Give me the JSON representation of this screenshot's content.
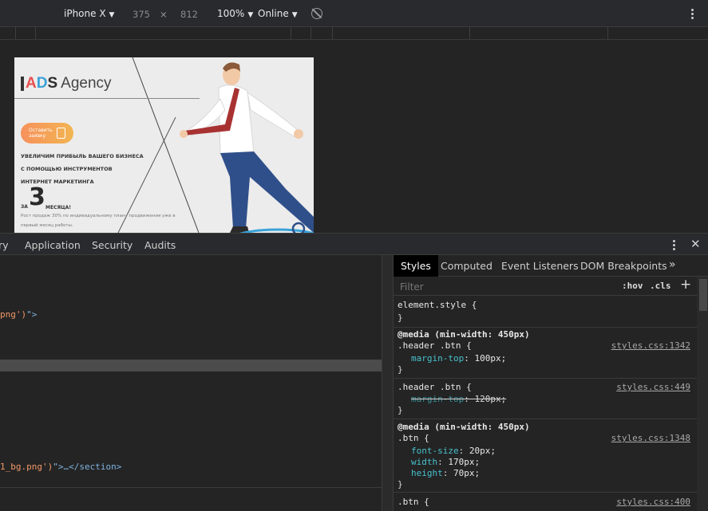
{
  "device_toolbar": {
    "device": "iPhone X",
    "width": "375",
    "times": "×",
    "height": "812",
    "zoom": "100%",
    "network": "Online"
  },
  "page": {
    "logo_a": "A",
    "logo_d": "D",
    "logo_s": "S",
    "logo_agency": "Agency",
    "cta_line1": "Оставить",
    "cta_line2": "заявку",
    "headline": [
      "УВЕЛИЧИМ ПРИБЫЛЬ ВАШЕГО БИЗНЕСА",
      "С ПОМОЩЬЮ ИНСТРУМЕНТОВ",
      "ИНТЕРНЕТ МАРКЕТИНГА"
    ],
    "za": "ЗА",
    "big_number": "3",
    "months": "МЕСЯЦА!",
    "note": [
      "Рост продаж 30% по индивидуальному плану продвижения уже в",
      "первый месяц работы."
    ]
  },
  "devtools": {
    "tabs": [
      "ry",
      "Application",
      "Security",
      "Audits"
    ],
    "elements": {
      "line1_str": "png')",
      "line1_tail": "\">",
      "line2_str": "1_bg.png')",
      "line2_tail": "\">…</section>"
    },
    "styles_tabs": [
      "Styles",
      "Computed",
      "Event Listeners",
      "DOM Breakpoints",
      "»"
    ],
    "filter_placeholder": "Filter",
    "hov": ":hov",
    "cls": ".cls",
    "plus": "+",
    "rules": {
      "element_style": "element.style {",
      "close": "}",
      "r1_media": "@media (min-width: 450px)",
      "r1_selector": ".header .btn {",
      "r1_source": "styles.css:1342",
      "r1_prop": "margin-top",
      "r1_value": "100px;",
      "r2_selector": ".header .btn {",
      "r2_source": "styles.css:449",
      "r2_prop": "margin-top",
      "r2_value": "120px;",
      "r3_media": "@media (min-width: 450px)",
      "r3_selector": ".btn {",
      "r3_source": "styles.css:1348",
      "r3_props": [
        {
          "prop": "font-size",
          "value": "20px;"
        },
        {
          "prop": "width",
          "value": "170px;"
        },
        {
          "prop": "height",
          "value": "70px;"
        }
      ],
      "r4_selector": ".btn {",
      "r4_source": "styles.css:400"
    }
  },
  "colors": {
    "toolbar_bg": "#292a2d",
    "panel_bg": "#242424",
    "css_property": "#48c1cc",
    "string": "#f29766",
    "tag": "#7fb3e0"
  }
}
